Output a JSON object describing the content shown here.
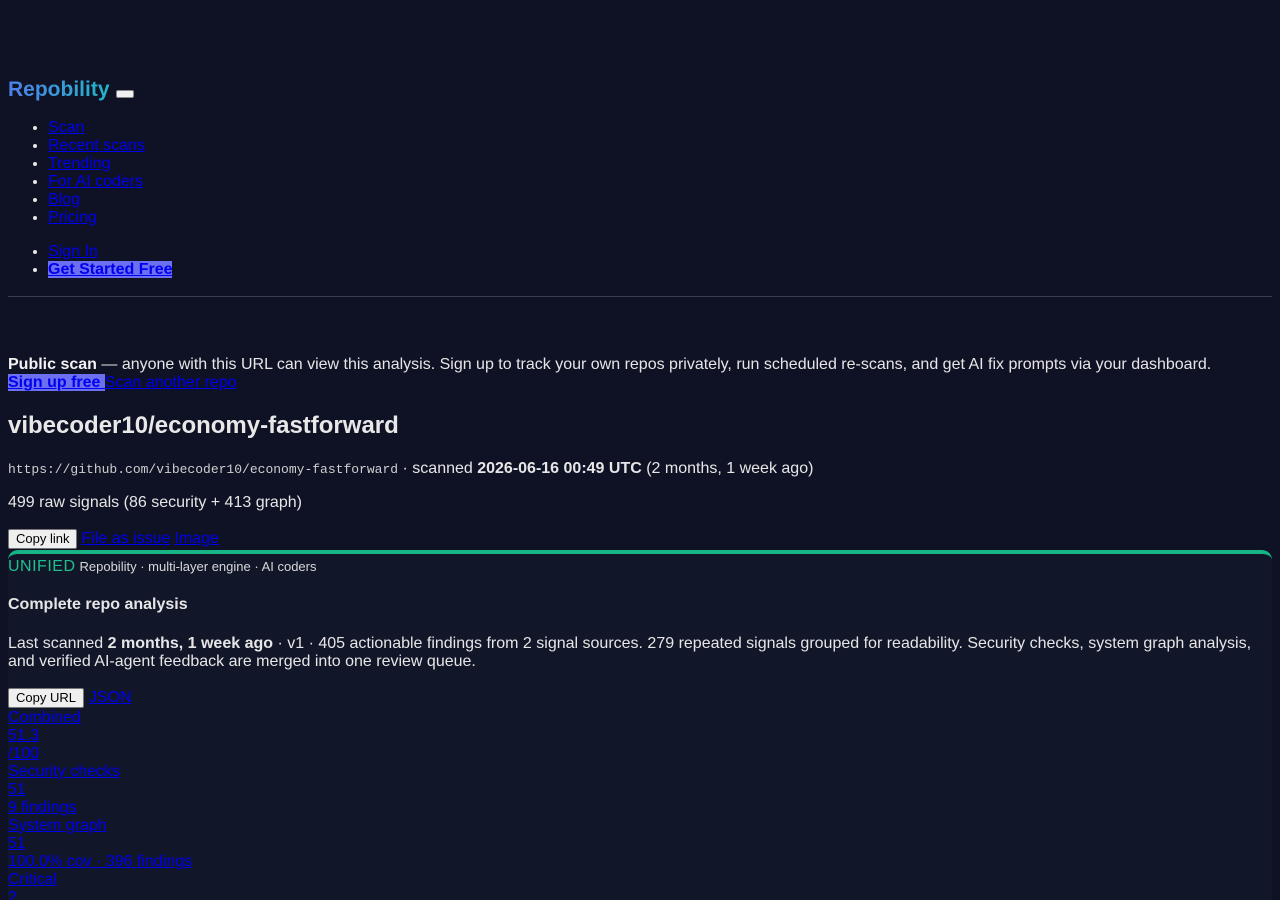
{
  "header": {
    "brand": "Repobility",
    "nav": [
      "Scan",
      "Recent scans",
      "Trending",
      "For AI coders",
      "Blog",
      "Pricing"
    ],
    "auth": {
      "sign_in": "Sign In",
      "get_started": "Get Started Free"
    }
  },
  "notice": {
    "label": "Public scan",
    "text": " — anyone with this URL can view this analysis. Sign up to track your own repos privately, run scheduled re-scans, and get AI fix prompts via your dashboard.",
    "signup": "Sign up free ",
    "scan_another": "Scan another repo"
  },
  "repo": {
    "title": "vibecoder10/economy-fastforward",
    "url": "https://github.com/vibecoder10/economy-fastforward",
    "scanned_prefix": " · scanned ",
    "scanned_at": "2026-06-16 00:49 UTC",
    "scanned_ago": " (2 months, 1 week ago)",
    "signals": "499 raw signals (86 security + 413 graph)"
  },
  "actions": {
    "copy_link": "Copy link",
    "file_issue": "File as issue",
    "image": "Image"
  },
  "card": {
    "badge": "UNIFIED",
    "subtitle": "Repobility · multi-layer engine · AI coders",
    "title": "Complete repo analysis",
    "desc_prefix": "Last scanned ",
    "desc_time": "2 months, 1 week ago",
    "desc_rest": " · v1 · 405 actionable findings from 2 signal sources. 279 repeated signals grouped for readability. Security checks, system graph analysis, and verified AI-agent feedback are merged into one review queue.",
    "copy_url": "Copy URL",
    "json": "JSON",
    "metrics": [
      "Combined",
      "51.3",
      "/100",
      "Security checks",
      "51",
      "9 findings",
      "System graph",
      "51",
      "100.0% cov · 396 findings",
      "Critical",
      "2"
    ]
  },
  "colors": {
    "background": "#0f1125",
    "accent_green": "#1fbf8f",
    "brand_blue": "#4f7fe8",
    "cta": "#6c6ff0"
  }
}
